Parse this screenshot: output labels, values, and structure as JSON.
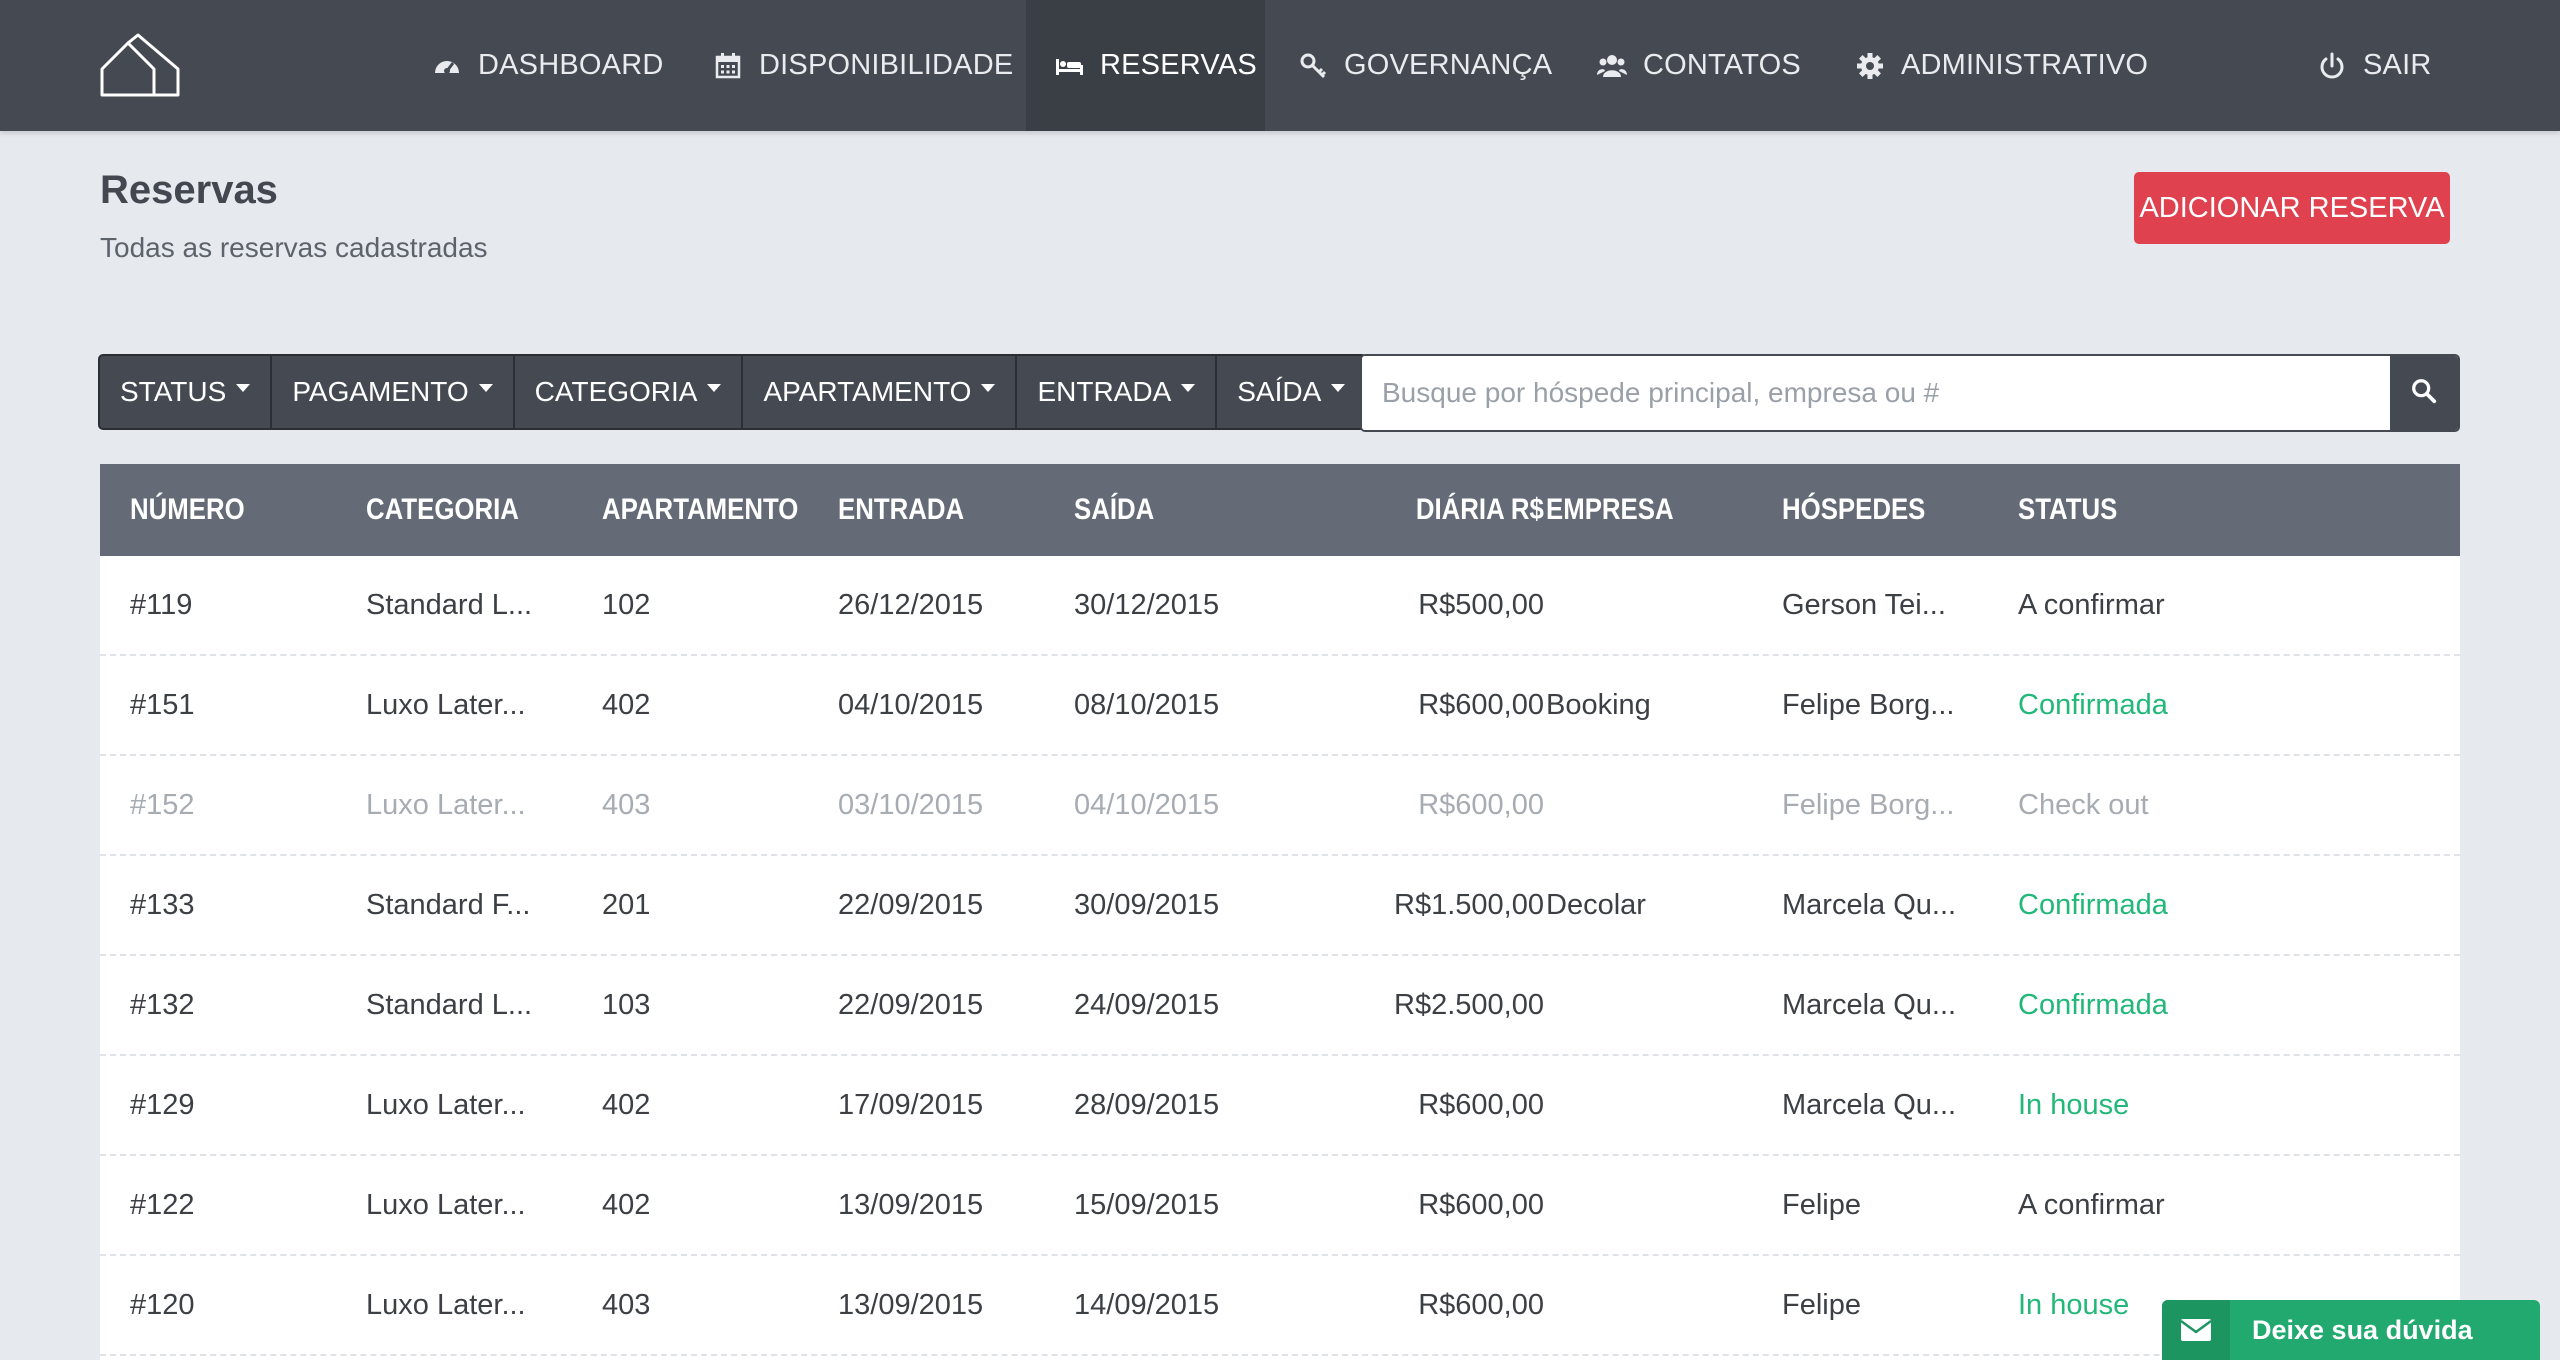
{
  "nav": {
    "items": [
      {
        "label": "DASHBOARD",
        "icon": "dashboard-icon"
      },
      {
        "label": "DISPONIBILIDADE",
        "icon": "calendar-icon"
      },
      {
        "label": "RESERVAS",
        "icon": "bed-icon",
        "active": true
      },
      {
        "label": "GOVERNANÇA",
        "icon": "key-icon"
      },
      {
        "label": "CONTATOS",
        "icon": "users-icon"
      },
      {
        "label": "ADMINISTRATIVO",
        "icon": "gear-icon"
      },
      {
        "label": "SAIR",
        "icon": "power-icon"
      }
    ]
  },
  "page": {
    "title": "Reservas",
    "subtitle": "Todas as reservas cadastradas",
    "add_button": "ADICIONAR RESERVA"
  },
  "filters": [
    "STATUS",
    "PAGAMENTO",
    "CATEGORIA",
    "APARTAMENTO",
    "ENTRADA",
    "SAÍDA"
  ],
  "search": {
    "placeholder": "Busque por hóspede principal, empresa ou #",
    "value": ""
  },
  "table": {
    "columns": [
      "NÚMERO",
      "CATEGORIA",
      "APARTAMENTO",
      "ENTRADA",
      "SAÍDA",
      "DIÁRIA R$",
      "EMPRESA",
      "HÓSPEDES",
      "STATUS"
    ],
    "rows": [
      {
        "numero": "#119",
        "categoria": "Standard L...",
        "apartamento": "102",
        "entrada": "26/12/2015",
        "saida": "30/12/2015",
        "diaria": "R$500,00",
        "empresa": "",
        "hospedes": "Gerson Tei...",
        "status": "A confirmar",
        "status_style": "normal",
        "muted": false
      },
      {
        "numero": "#151",
        "categoria": "Luxo Later...",
        "apartamento": "402",
        "entrada": "04/10/2015",
        "saida": "08/10/2015",
        "diaria": "R$600,00",
        "empresa": "Booking",
        "hospedes": "Felipe Borg...",
        "status": "Confirmada",
        "status_style": "green",
        "muted": false
      },
      {
        "numero": "#152",
        "categoria": "Luxo Later...",
        "apartamento": "403",
        "entrada": "03/10/2015",
        "saida": "04/10/2015",
        "diaria": "R$600,00",
        "empresa": "",
        "hospedes": "Felipe Borg...",
        "status": "Check out",
        "status_style": "muted",
        "muted": true
      },
      {
        "numero": "#133",
        "categoria": "Standard F...",
        "apartamento": "201",
        "entrada": "22/09/2015",
        "saida": "30/09/2015",
        "diaria": "R$1.500,00",
        "empresa": "Decolar",
        "hospedes": "Marcela Qu...",
        "status": "Confirmada",
        "status_style": "green",
        "muted": false
      },
      {
        "numero": "#132",
        "categoria": "Standard L...",
        "apartamento": "103",
        "entrada": "22/09/2015",
        "saida": "24/09/2015",
        "diaria": "R$2.500,00",
        "empresa": "",
        "hospedes": "Marcela Qu...",
        "status": "Confirmada",
        "status_style": "green",
        "muted": false
      },
      {
        "numero": "#129",
        "categoria": "Luxo Later...",
        "apartamento": "402",
        "entrada": "17/09/2015",
        "saida": "28/09/2015",
        "diaria": "R$600,00",
        "empresa": "",
        "hospedes": "Marcela Qu...",
        "status": "In house",
        "status_style": "green",
        "muted": false
      },
      {
        "numero": "#122",
        "categoria": "Luxo Later...",
        "apartamento": "402",
        "entrada": "13/09/2015",
        "saida": "15/09/2015",
        "diaria": "R$600,00",
        "empresa": "",
        "hospedes": "Felipe",
        "status": "A confirmar",
        "status_style": "normal",
        "muted": false
      },
      {
        "numero": "#120",
        "categoria": "Luxo Later...",
        "apartamento": "403",
        "entrada": "13/09/2015",
        "saida": "14/09/2015",
        "diaria": "R$600,00",
        "empresa": "",
        "hospedes": "Felipe",
        "status": "In house",
        "status_style": "green",
        "muted": false
      }
    ]
  },
  "help_widget": {
    "label": "Deixe sua dúvida",
    "icon": "envelope-icon"
  },
  "colors": {
    "nav_bg": "#454a52",
    "accent_red": "#e0414f",
    "status_green": "#22b87a",
    "table_header": "#646b76",
    "help_green": "#22a96f"
  }
}
